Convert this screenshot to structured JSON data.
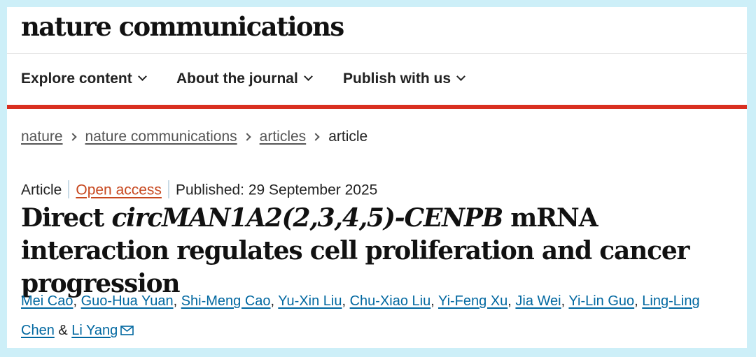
{
  "site": {
    "brand": "nature communications"
  },
  "nav": {
    "items": [
      {
        "label": "Explore content"
      },
      {
        "label": "About the journal"
      },
      {
        "label": "Publish with us"
      }
    ]
  },
  "breadcrumb": {
    "items": [
      "nature",
      "nature communications",
      "articles"
    ],
    "current": "article"
  },
  "article": {
    "type": "Article",
    "access": "Open access",
    "published": "Published: 29 September 2025",
    "title_prefix": "Direct ",
    "title_italic": "circMAN1A2(2,3,4,5)-CENPB",
    "title_suffix": " mRNA interaction regulates cell proliferation and cancer progression",
    "authors": [
      "Mei Cao",
      "Guo-Hua Yuan",
      "Shi-Meng Cao",
      "Yu-Xin Liu",
      "Chu-Xiao Liu",
      "Yi-Feng Xu",
      "Jia Wei",
      "Yi-Lin Guo",
      "Ling-Ling Chen",
      "Li Yang"
    ],
    "author_separator": ", ",
    "author_last_joiner": " & "
  },
  "colors": {
    "page_background": "#cdeff8",
    "accent_bar": "#d92f20",
    "author_link": "#0067a0",
    "open_access": "#c7471e"
  },
  "icons": {
    "corresponding_author": "mail-icon"
  }
}
